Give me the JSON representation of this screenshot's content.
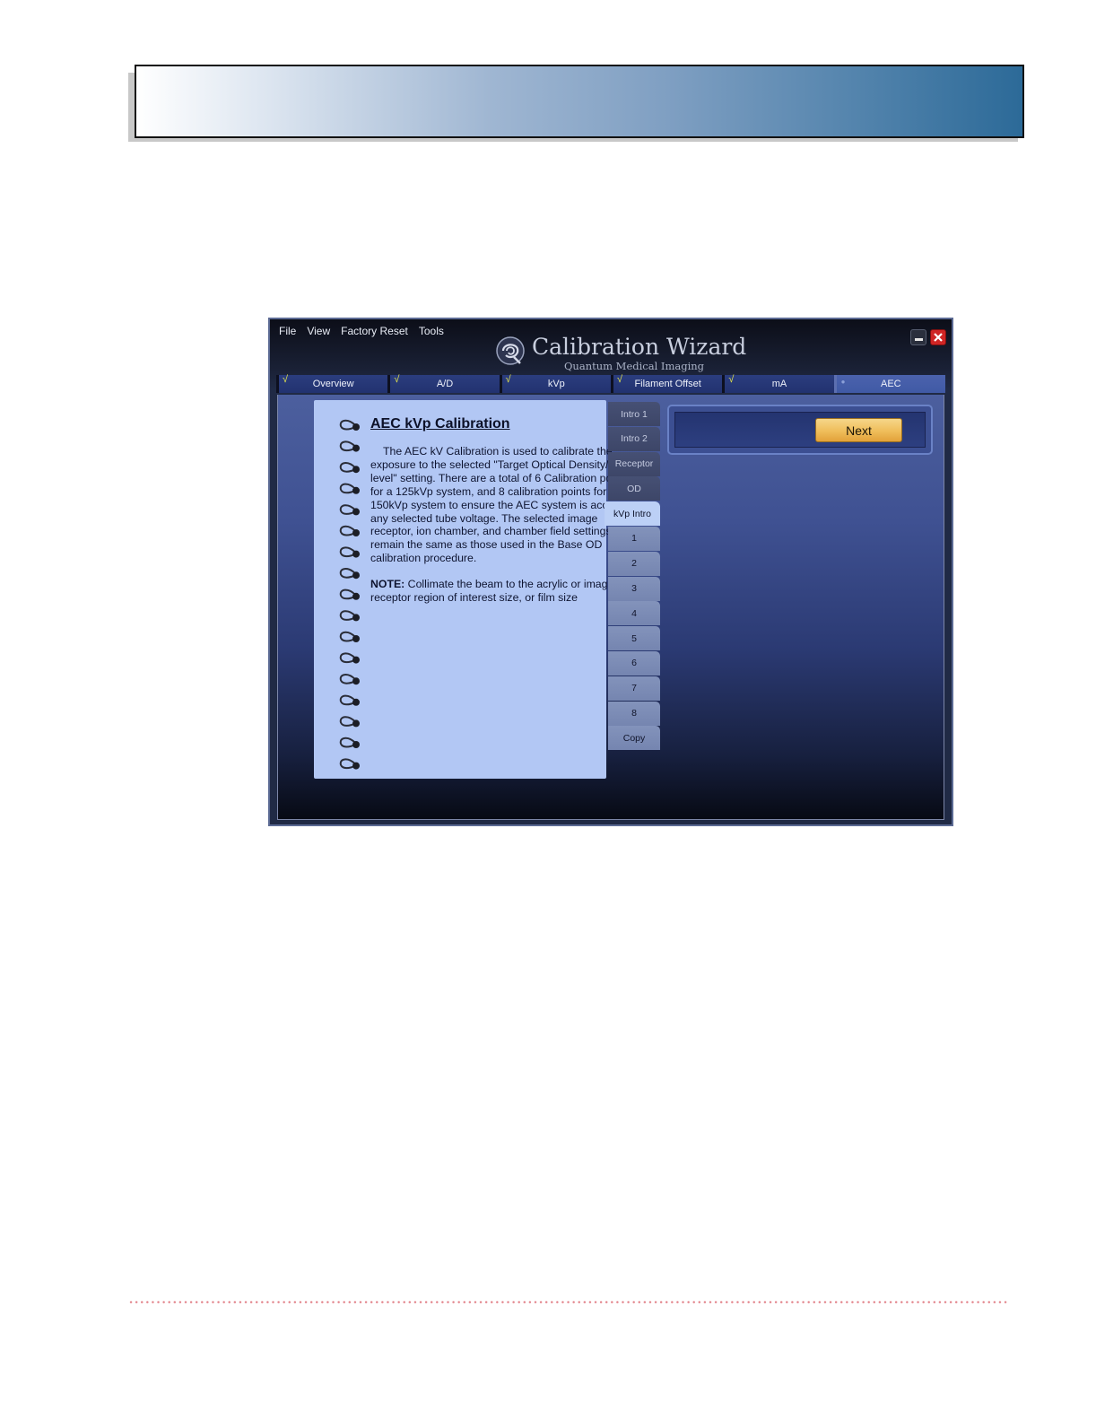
{
  "app": {
    "menu": [
      "File",
      "View",
      "Factory Reset",
      "Tools"
    ],
    "logo": {
      "title": "Calibration Wizard",
      "subtitle": "Quantum Medical Imaging"
    },
    "window_controls": {
      "minimize_icon": "minimize-icon",
      "close_icon": "close-icon"
    },
    "tabs": [
      {
        "label": "Overview",
        "completed": true
      },
      {
        "label": "A/D",
        "completed": true
      },
      {
        "label": "kVp",
        "completed": true
      },
      {
        "label": "Filament Offset",
        "completed": true
      },
      {
        "label": "mA",
        "completed": true
      },
      {
        "label": "AEC",
        "completed": false,
        "active": true
      }
    ],
    "check_mark": "√",
    "notebook": {
      "title": "AEC kVp Calibration",
      "body": "The AEC kV Calibration is used to calibrate the exposure to the selected \"Target Optical Density/ gray level\" setting. There are a total of 6 Calibration points for a 125kVp system, and 8 calibration points for a 150kVp system to ensure the AEC system is accurate any selected tube voltage. The selected image receptor, ion chamber, and chamber field settings remain the same as those used in the Base OD calibration procedure.",
      "note_label": "NOTE:",
      "note_text": " Collimate the beam to the acrylic or image receptor region of interest size, or film size"
    },
    "side_tabs": [
      "Intro 1",
      "Intro 2",
      "Receptor",
      "OD",
      "kVp Intro",
      "1",
      "2",
      "3",
      "4",
      "5",
      "6",
      "7",
      "8",
      "Copy"
    ],
    "side_tab_active": "kVp Intro",
    "next_button": "Next",
    "colors": {
      "banner_end": "#2c6a98",
      "tab_bg": "#223270",
      "notebook_bg": "#b2c7f4",
      "next_button": "#efbd5a",
      "close_button": "#cf2525",
      "footer_dots": "#e07a82"
    }
  }
}
